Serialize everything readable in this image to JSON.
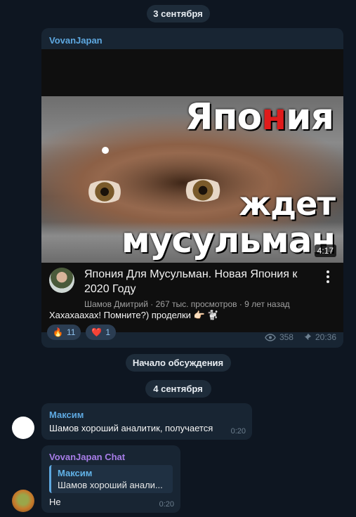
{
  "date_pill_1": "3 сентября",
  "post": {
    "author": "VovanJapan",
    "video": {
      "thumbnail_text": [
        "Япо",
        "н",
        "ия",
        "ждет",
        "мусульман"
      ],
      "duration": "4:17",
      "title": "Япония Для Мусульман. Новая Япония к 2020 Году",
      "meta": "Шамов Дмитрий · 267 тыс. просмотров · 9 лет назад"
    },
    "caption": "Хахахаахах! Помните?) проделки 👉🏻 🐩",
    "reactions": [
      {
        "emoji": "🔥",
        "count": "11"
      },
      {
        "emoji": "❤️",
        "count": "1"
      }
    ],
    "views": "358",
    "time": "20:36"
  },
  "discussion_pill": "Начало обсуждения",
  "date_pill_2": "4 сентября",
  "comments": [
    {
      "author": "Максим",
      "text": "Шамов хороший аналитик, получается",
      "time": "0:20",
      "author_color": "#5ea8e0"
    },
    {
      "author": "VovanJapan Chat",
      "reply_author": "Максим",
      "reply_text": "Шамов хороший анали...",
      "text": "Не",
      "time": "0:20",
      "author_color": "#a77de8"
    }
  ]
}
